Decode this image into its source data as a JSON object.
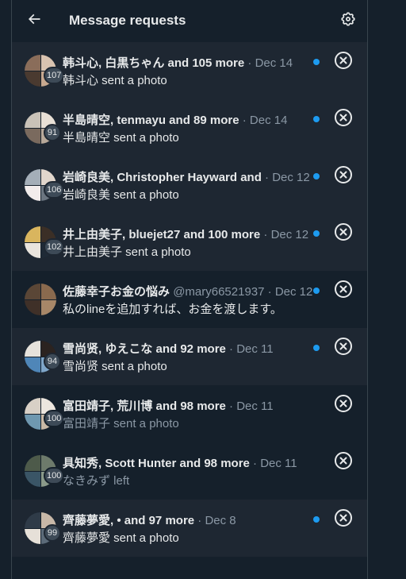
{
  "header": {
    "title": "Message requests"
  },
  "requests": [
    {
      "name": "韩斗心, 白黒ちゃん and 105 more",
      "handle": "",
      "sep": " · ",
      "date": "Dec 14",
      "preview": "韩斗心 sent a photo",
      "count": "107",
      "unread": true,
      "colors": [
        "#8a6d5a",
        "#d9c3b0",
        "#4a3a30",
        "#c7a88f"
      ]
    },
    {
      "name": "半島晴空, tenmayu and 89 more",
      "handle": "",
      "sep": " · ",
      "date": "Dec 14",
      "preview": "半島晴空 sent a photo",
      "count": "91",
      "unread": true,
      "colors": [
        "#c9c2b8",
        "#e8e0d6",
        "#7a6a5e",
        "#b8a99a"
      ]
    },
    {
      "name": "岩崎良美, Christopher Hayward and",
      "handle": "",
      "sep": " · ",
      "date": "Dec 12",
      "preview": "岩崎良美 sent a photo",
      "count": "106",
      "unread": true,
      "colors": [
        "#a4aeb8",
        "#e1d6cc",
        "#f2ecec",
        "#6b7580"
      ]
    },
    {
      "name": "井上由美子, bluejet27 and 100 more",
      "handle": "",
      "sep": " · ",
      "date": "Dec 12",
      "preview": "井上由美子 sent a photo",
      "count": "102",
      "unread": true,
      "colors": [
        "#d9b55e",
        "#3b2f26",
        "#e9e4dd",
        "#1f2a36"
      ]
    },
    {
      "name": "佐藤幸子お金の悩み",
      "handle": "@mary66521937",
      "sep": " · ",
      "date": "Dec 12",
      "preview": "私のlineを追加すれば、お金を渡します。",
      "count": "",
      "unread": true,
      "colors": [
        "#5a4636",
        "#8a6a4e",
        "#3f3028",
        "#a78768"
      ]
    },
    {
      "name": "雪尚贤, ゆえこな and 92 more",
      "handle": "",
      "sep": " · ",
      "date": "Dec 11",
      "preview": "雪尚贤 sent a photo",
      "count": "94",
      "unread": true,
      "colors": [
        "#e6e2dc",
        "#2b2320",
        "#4f86b8",
        "#7fa6c9"
      ]
    },
    {
      "name": "富田靖子, 荒川博 and 98 more",
      "handle": "",
      "sep": " · ",
      "date": "Dec 11",
      "preview": "富田靖子 sent a photo",
      "count": "100",
      "unread": false,
      "colors": [
        "#d8d0c6",
        "#ece6de",
        "#6f98b0",
        "#c9b9a6"
      ]
    },
    {
      "name": "具知秀, Scott Hunter and 98 more",
      "handle": "",
      "sep": " · ",
      "date": "Dec 11",
      "preview": "なきみず left",
      "count": "100",
      "unread": false,
      "colors": [
        "#4d5a4a",
        "#6d7a6b",
        "#3a5566",
        "#8a9a8a"
      ]
    },
    {
      "name": "齊藤夢愛, • and 97 more",
      "handle": "",
      "sep": " · ",
      "date": "Dec 8",
      "preview": "齊藤夢愛 sent a photo",
      "count": "99",
      "unread": true,
      "colors": [
        "#2f3b48",
        "#c8b8a8",
        "#e6e0d8",
        "#5c6b79"
      ]
    }
  ],
  "icons": {
    "back": "arrow-left-icon",
    "settings": "gear-icon",
    "dismiss": "close-circle-icon"
  },
  "colors": {
    "background": "#15202b",
    "row_background": "#1e2732",
    "accent": "#1d9bf0",
    "muted_text": "#8b98a5"
  }
}
